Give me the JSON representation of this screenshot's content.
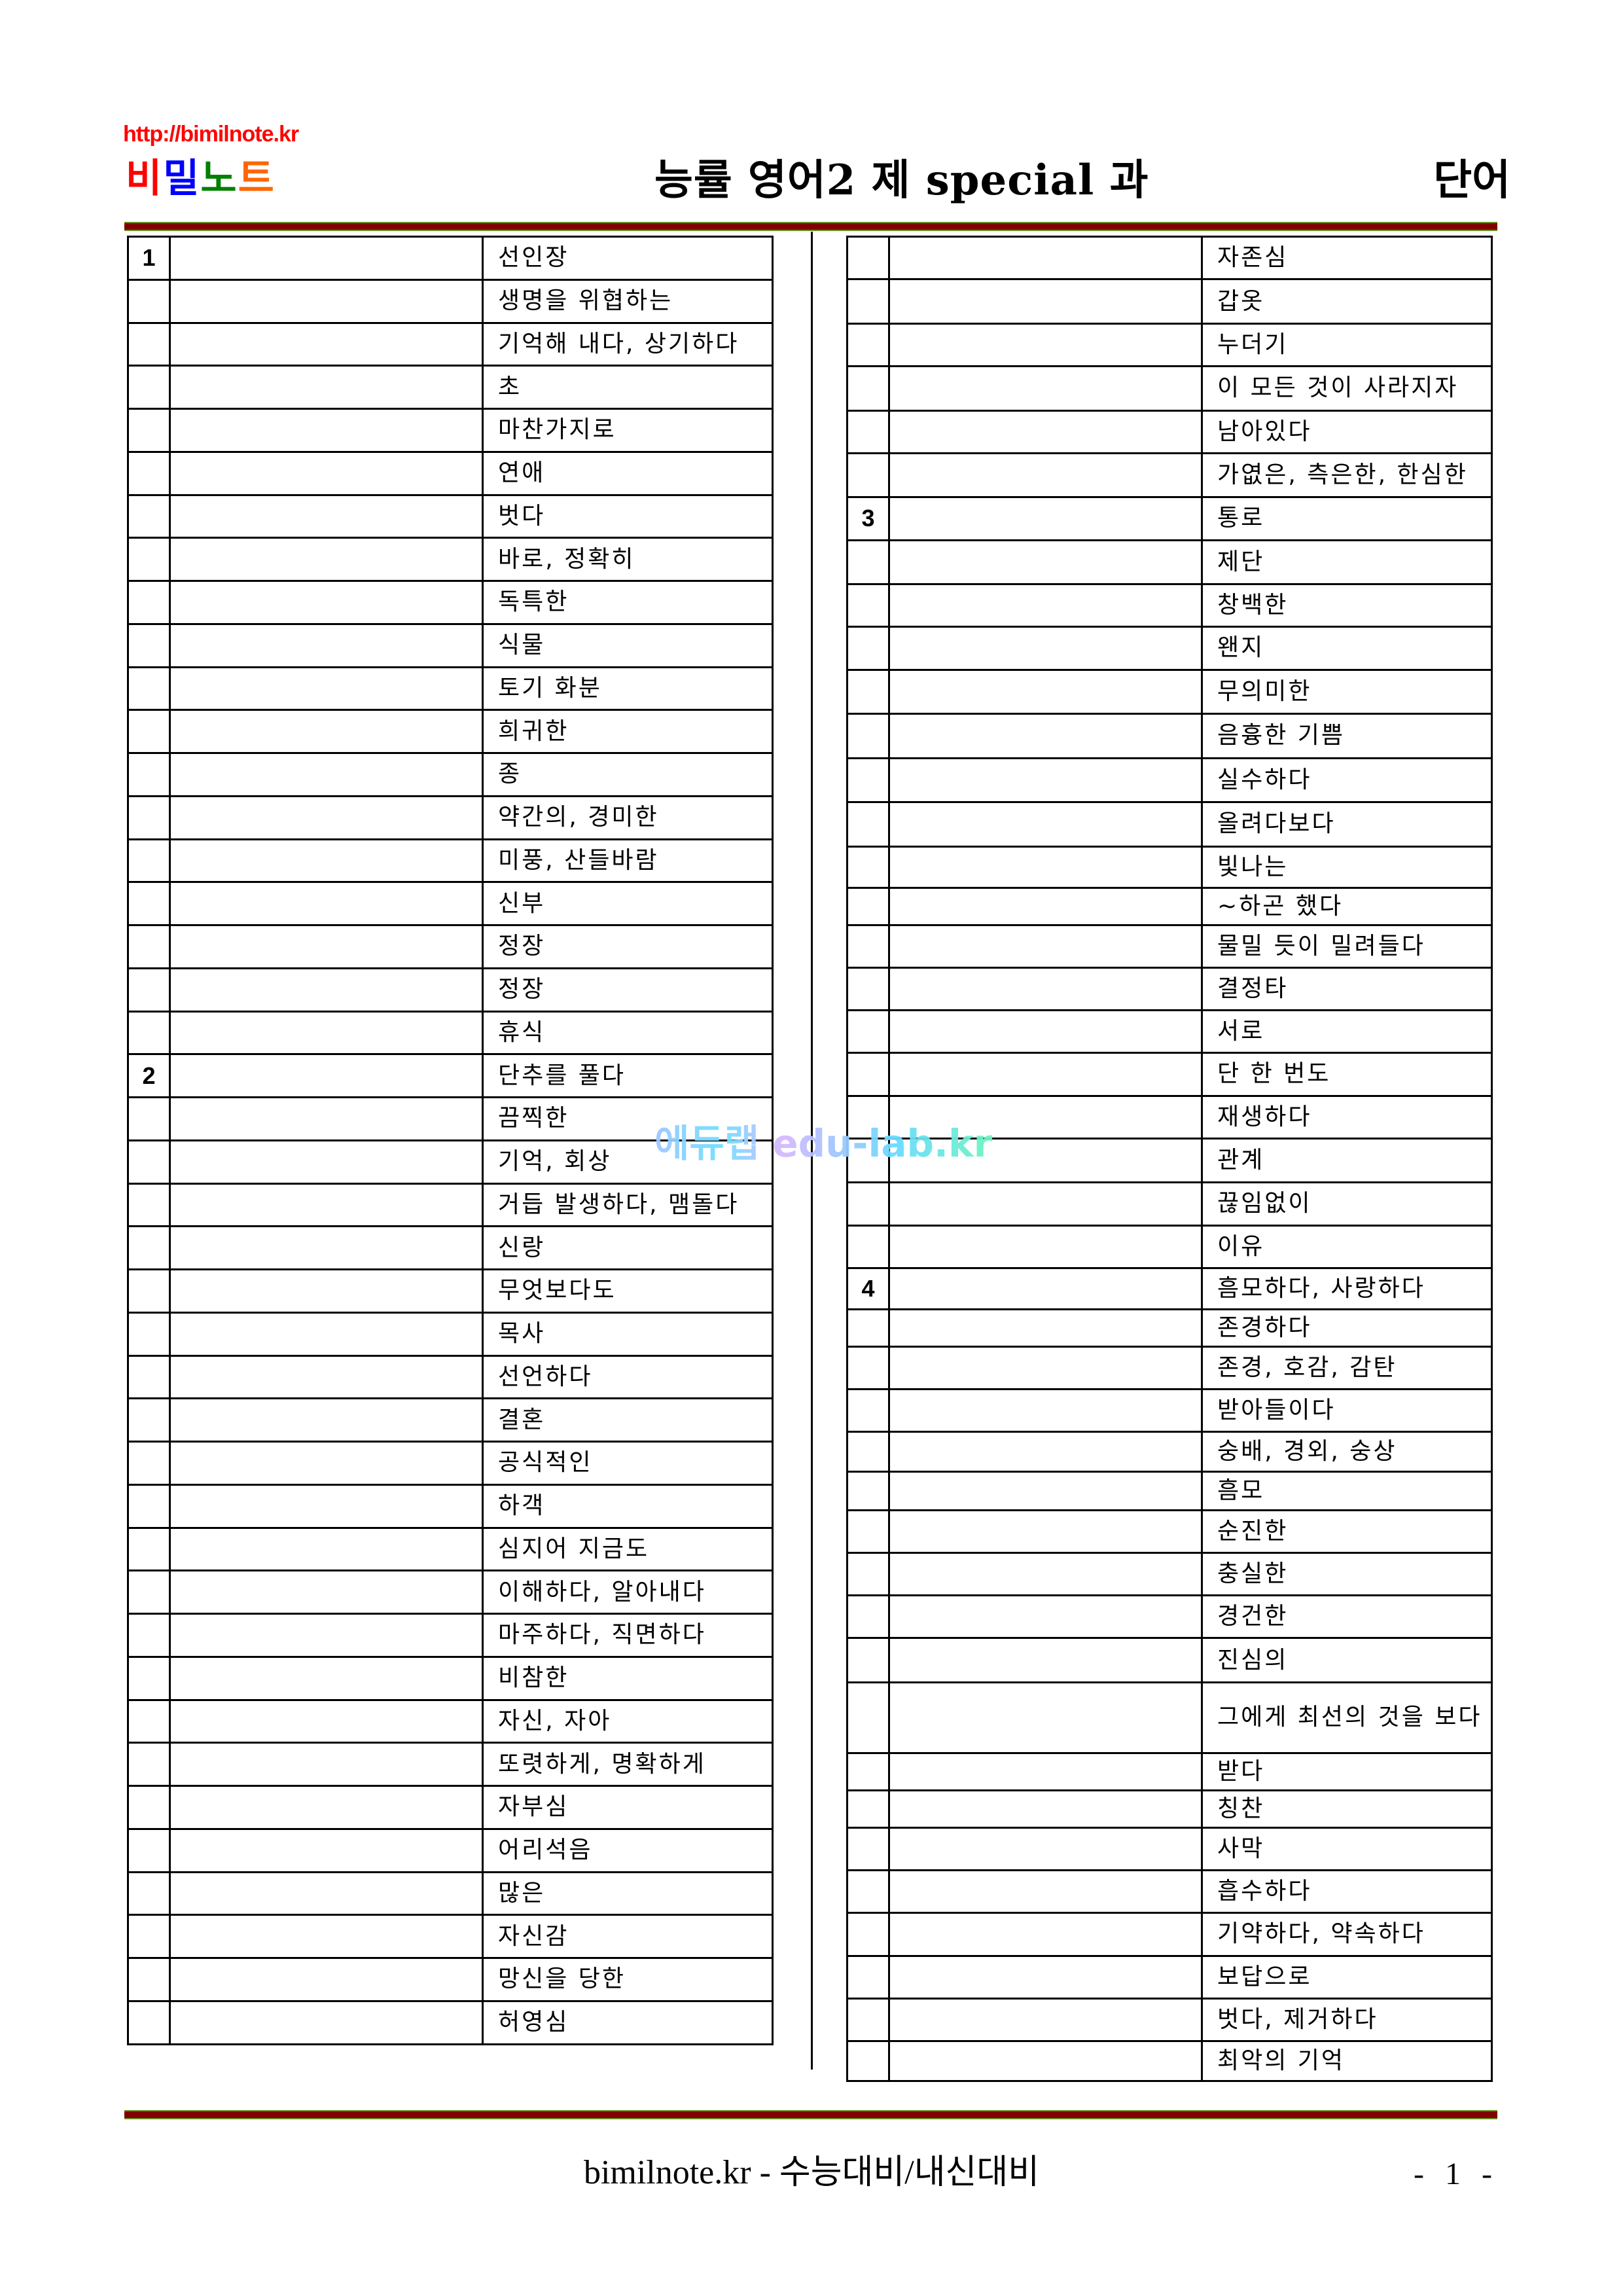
{
  "header": {
    "site_url": "http://bimilnote.kr",
    "logo": [
      {
        "char": "비",
        "color": "#ff0000"
      },
      {
        "char": "밀",
        "color": "#0000ff"
      },
      {
        "char": "노",
        "color": "#008000"
      },
      {
        "char": "트",
        "color": "#ff6600"
      }
    ],
    "title": "능률 영어2 제 special 과",
    "title_right": "단어"
  },
  "watermark": "에듀랩 edu-lab.kr",
  "left_table": {
    "rows": [
      {
        "num": "1",
        "word": "",
        "meaning": "선인장"
      },
      {
        "num": "",
        "word": "",
        "meaning": "생명을 위협하는"
      },
      {
        "num": "",
        "word": "",
        "meaning": "기억해 내다, 상기하다"
      },
      {
        "num": "",
        "word": "",
        "meaning": "초"
      },
      {
        "num": "",
        "word": "",
        "meaning": "마찬가지로"
      },
      {
        "num": "",
        "word": "",
        "meaning": "연애"
      },
      {
        "num": "",
        "word": "",
        "meaning": "벗다"
      },
      {
        "num": "",
        "word": "",
        "meaning": "바로, 정확히"
      },
      {
        "num": "",
        "word": "",
        "meaning": "독특한"
      },
      {
        "num": "",
        "word": "",
        "meaning": "식물"
      },
      {
        "num": "",
        "word": "",
        "meaning": "토기 화분"
      },
      {
        "num": "",
        "word": "",
        "meaning": "희귀한"
      },
      {
        "num": "",
        "word": "",
        "meaning": "종"
      },
      {
        "num": "",
        "word": "",
        "meaning": "약간의, 경미한"
      },
      {
        "num": "",
        "word": "",
        "meaning": "미풍, 산들바람"
      },
      {
        "num": "",
        "word": "",
        "meaning": "신부"
      },
      {
        "num": "",
        "word": "",
        "meaning": "정장"
      },
      {
        "num": "",
        "word": "",
        "meaning": "정장"
      },
      {
        "num": "",
        "word": "",
        "meaning": "휴식"
      },
      {
        "num": "2",
        "word": "",
        "meaning": "단추를 풀다"
      },
      {
        "num": "",
        "word": "",
        "meaning": "끔찍한"
      },
      {
        "num": "",
        "word": "",
        "meaning": "기억, 회상"
      },
      {
        "num": "",
        "word": "",
        "meaning": "거듭 발생하다, 맴돌다"
      },
      {
        "num": "",
        "word": "",
        "meaning": "신랑"
      },
      {
        "num": "",
        "word": "",
        "meaning": "무엇보다도"
      },
      {
        "num": "",
        "word": "",
        "meaning": "목사"
      },
      {
        "num": "",
        "word": "",
        "meaning": "선언하다"
      },
      {
        "num": "",
        "word": "",
        "meaning": "결혼"
      },
      {
        "num": "",
        "word": "",
        "meaning": "공식적인"
      },
      {
        "num": "",
        "word": "",
        "meaning": "하객"
      },
      {
        "num": "",
        "word": "",
        "meaning": "심지어 지금도"
      },
      {
        "num": "",
        "word": "",
        "meaning": "이해하다, 알아내다"
      },
      {
        "num": "",
        "word": "",
        "meaning": "마주하다, 직면하다"
      },
      {
        "num": "",
        "word": "",
        "meaning": "비참한"
      },
      {
        "num": "",
        "word": "",
        "meaning": "자신, 자아"
      },
      {
        "num": "",
        "word": "",
        "meaning": "또렷하게, 명확하게"
      },
      {
        "num": "",
        "word": "",
        "meaning": "자부심"
      },
      {
        "num": "",
        "word": "",
        "meaning": "어리석음"
      },
      {
        "num": "",
        "word": "",
        "meaning": "많은"
      },
      {
        "num": "",
        "word": "",
        "meaning": "자신감"
      },
      {
        "num": "",
        "word": "",
        "meaning": "망신을 당한"
      },
      {
        "num": "",
        "word": "",
        "meaning": "허영심"
      }
    ]
  },
  "right_table": {
    "rows": [
      {
        "num": "",
        "word": "",
        "meaning": "자존심"
      },
      {
        "num": "",
        "word": "",
        "meaning": "갑옷"
      },
      {
        "num": "",
        "word": "",
        "meaning": "누더기"
      },
      {
        "num": "",
        "word": "",
        "meaning": "이 모든 것이 사라지자"
      },
      {
        "num": "",
        "word": "",
        "meaning": "남아있다"
      },
      {
        "num": "",
        "word": "",
        "meaning": "가엾은, 측은한, 한심한"
      },
      {
        "num": "3",
        "word": "",
        "meaning": "통로"
      },
      {
        "num": "",
        "word": "",
        "meaning": "제단"
      },
      {
        "num": "",
        "word": "",
        "meaning": "창백한"
      },
      {
        "num": "",
        "word": "",
        "meaning": "왠지"
      },
      {
        "num": "",
        "word": "",
        "meaning": "무의미한"
      },
      {
        "num": "",
        "word": "",
        "meaning": "음흉한 기쁨"
      },
      {
        "num": "",
        "word": "",
        "meaning": "실수하다"
      },
      {
        "num": "",
        "word": "",
        "meaning": "올려다보다"
      },
      {
        "num": "",
        "word": "",
        "meaning": "빛나는"
      },
      {
        "num": "",
        "word": "",
        "meaning": "~하곤 했다"
      },
      {
        "num": "",
        "word": "",
        "meaning": "물밀 듯이 밀려들다"
      },
      {
        "num": "",
        "word": "",
        "meaning": "결정타"
      },
      {
        "num": "",
        "word": "",
        "meaning": "서로"
      },
      {
        "num": "",
        "word": "",
        "meaning": "단 한 번도"
      },
      {
        "num": "",
        "word": "",
        "meaning": "재생하다"
      },
      {
        "num": "",
        "word": "",
        "meaning": "관계"
      },
      {
        "num": "",
        "word": "",
        "meaning": "끊임없이"
      },
      {
        "num": "",
        "word": "",
        "meaning": "이유"
      },
      {
        "num": "4",
        "word": "",
        "meaning": "흠모하다, 사랑하다"
      },
      {
        "num": "",
        "word": "",
        "meaning": "존경하다"
      },
      {
        "num": "",
        "word": "",
        "meaning": "존경, 호감, 감탄"
      },
      {
        "num": "",
        "word": "",
        "meaning": "받아들이다"
      },
      {
        "num": "",
        "word": "",
        "meaning": "숭배, 경외, 숭상"
      },
      {
        "num": "",
        "word": "",
        "meaning": "흠모"
      },
      {
        "num": "",
        "word": "",
        "meaning": "순진한"
      },
      {
        "num": "",
        "word": "",
        "meaning": "충실한"
      },
      {
        "num": "",
        "word": "",
        "meaning": "경건한"
      },
      {
        "num": "",
        "word": "",
        "meaning": "진심의"
      },
      {
        "num": "",
        "word": "",
        "meaning": "그에게 최선의 것을 보다"
      },
      {
        "num": "",
        "word": "",
        "meaning": "받다"
      },
      {
        "num": "",
        "word": "",
        "meaning": "칭찬"
      },
      {
        "num": "",
        "word": "",
        "meaning": "사막"
      },
      {
        "num": "",
        "word": "",
        "meaning": "흡수하다"
      },
      {
        "num": "",
        "word": "",
        "meaning": "기약하다, 약속하다"
      },
      {
        "num": "",
        "word": "",
        "meaning": "보답으로"
      },
      {
        "num": "",
        "word": "",
        "meaning": "벗다, 제거하다"
      },
      {
        "num": "",
        "word": "",
        "meaning": "최악의 기억"
      }
    ]
  },
  "footer": {
    "text": "bimilnote.kr - 수능대비/내신대비",
    "page": "- 1 -"
  }
}
